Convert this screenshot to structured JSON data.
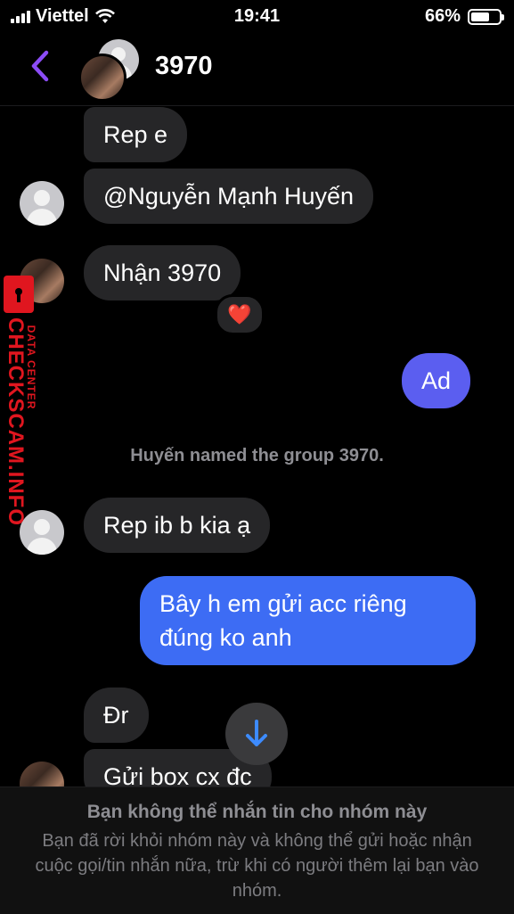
{
  "status_bar": {
    "carrier": "Viettel",
    "time": "19:41",
    "battery": "66%",
    "battery_level": 0.66
  },
  "header": {
    "title": "3970"
  },
  "messages": [
    {
      "text": "Rep e"
    },
    {
      "text": "@Nguyễn Mạnh Huyến"
    },
    {
      "text": "Nhận 3970",
      "reaction": "❤️"
    },
    {
      "text": "Ad"
    },
    {
      "system": "Huyến named the group 3970."
    },
    {
      "text": "Rep ib b kia ạ"
    },
    {
      "text": "Bây h em gửi acc riêng đúng ko anh"
    },
    {
      "text": "Đr"
    },
    {
      "text": "Gửi box cx đc"
    }
  ],
  "watermark": {
    "brand": "CHECKSCAM.INFO",
    "tagline": "DATA CENTER"
  },
  "footer": {
    "title": "Bạn không thể nhắn tin cho nhóm này",
    "description": "Bạn đã rời khỏi nhóm này và không thể gửi hoặc nhận cuộc gọi/tin nhắn nữa, trừ khi có người thêm lại bạn vào nhóm."
  },
  "colors": {
    "accent": "#8b4cf6",
    "outgoing_bubble": "#5b5ef0",
    "outgoing_bubble_alt": "#3d6cf4",
    "incoming_bubble": "#262628",
    "watermark": "#e0161f"
  }
}
